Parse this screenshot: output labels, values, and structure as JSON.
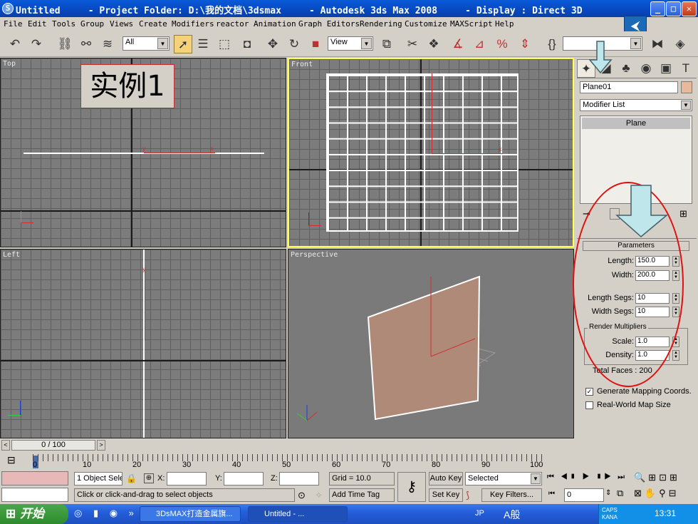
{
  "titlebar": {
    "title": "Untitled     - Project Folder: D:\\我的文档\\3dsmax     - Autodesk 3ds Max 2008     - Display : Direct 3D",
    "app_icon": "3ds-max-icon",
    "minimize": "_",
    "maximize": "□",
    "close": "✕"
  },
  "menu": [
    "File",
    "Edit",
    "Tools",
    "Group",
    "Views",
    "Create",
    "Modifiers",
    "reactor",
    "Animation",
    "Graph Editors",
    "Rendering",
    "Customize",
    "MAXScript",
    "Help"
  ],
  "toolbar": {
    "selection_filter": "All",
    "reference_coord": "View"
  },
  "viewports": {
    "top": {
      "label": "Top"
    },
    "front": {
      "label": "Front"
    },
    "left": {
      "label": "Left"
    },
    "perspective": {
      "label": "Perspective"
    },
    "overlay_text": "实例1",
    "axis_x": "x",
    "axis_y": "y",
    "axis_z": "z"
  },
  "command_panel": {
    "object_name": "Plane01",
    "object_color": "#e8b89a",
    "modifier_list": "Modifier List",
    "stack_item": "Plane",
    "rollout_title": "Parameters",
    "length_label": "Length:",
    "length_value": "150.0",
    "width_label": "Width:",
    "width_value": "200.0",
    "length_segs_label": "Length Segs:",
    "length_segs_value": "10",
    "width_segs_label": "Width Segs:",
    "width_segs_value": "10",
    "render_multipliers": "Render Multipliers",
    "scale_label": "Scale:",
    "scale_value": "1.0",
    "density_label": "Density:",
    "density_value": "1.0",
    "total_faces": "Total Faces : 200",
    "gen_mapping": "Generate Mapping Coords.",
    "gen_mapping_checked": true,
    "real_world": "Real-World Map Size",
    "real_world_checked": false
  },
  "timeline": {
    "frame": "0 / 100",
    "ticks": [
      "0",
      "10",
      "20",
      "30",
      "40",
      "50",
      "60",
      "70",
      "80",
      "90",
      "100"
    ]
  },
  "status": {
    "objects_selected": "1 Object Sele",
    "x_label": "X:",
    "y_label": "Y:",
    "z_label": "Z:",
    "grid": "Grid = 10.0",
    "prompt": "Click or click-and-drag to select objects",
    "add_time_tag": "Add Time Tag",
    "auto_key": "Auto Key",
    "set_key": "Set Key",
    "selected": "Selected",
    "key_filters": "Key Filters...",
    "frame_field": "0"
  },
  "taskbar": {
    "start": "开始",
    "task1": "3DsMAX打造金属旗...",
    "task2": "Untitled     - ...",
    "ime": "A般",
    "lang": "JP",
    "caps": "CAPS",
    "kana": "KANA",
    "clock": "13:31"
  }
}
